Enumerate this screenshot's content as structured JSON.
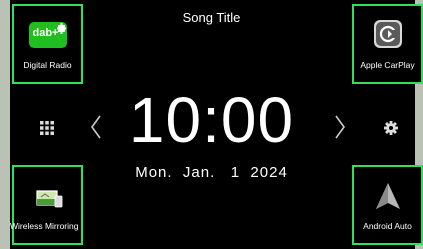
{
  "song": {
    "title": "Song Title"
  },
  "clock": {
    "time": "10:00",
    "date": "Mon.  Jan.   1  2024"
  },
  "shortcuts": [
    {
      "label": "Digital Radio",
      "icon": "dab-plus-icon",
      "badge": "dab+"
    },
    {
      "label": "Apple CarPlay",
      "icon": "carplay-icon"
    },
    {
      "label": "Wireless Mirroring",
      "icon": "wireless-mirroring-icon"
    },
    {
      "label": "Android Auto",
      "icon": "android-auto-icon"
    }
  ],
  "controls": {
    "menu_icon": "grid-menu-icon",
    "prev_icon": "chevron-left-icon",
    "next_icon": "chevron-right-icon",
    "settings_icon": "gear-icon"
  },
  "colors": {
    "highlight": "#2fe05a",
    "background": "#000000",
    "bezel": "#b9c2b5"
  }
}
